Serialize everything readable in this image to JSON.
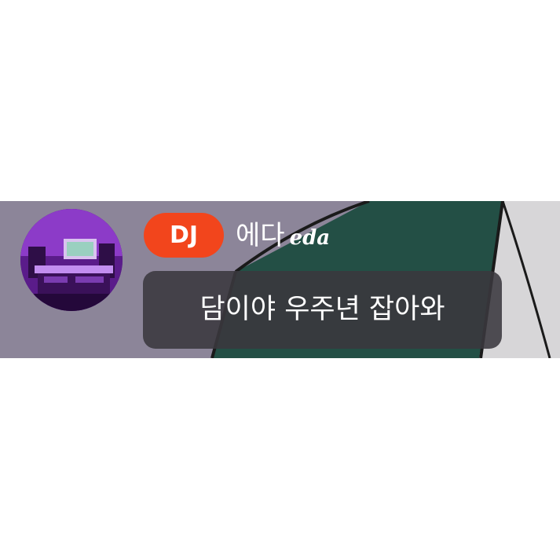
{
  "chat": {
    "author": {
      "role_badge": "DJ",
      "name": "에다",
      "name_latin": "eda",
      "avatar_icon": "studio-photo-avatar"
    },
    "message": {
      "text": "담이야 우주년 잡아와"
    }
  },
  "colors": {
    "strip_background": "#8c8599",
    "badge_background": "#f2451c",
    "bubble_background": "#3a383e",
    "text": "#ffffff",
    "scene_green": "#234f45"
  }
}
